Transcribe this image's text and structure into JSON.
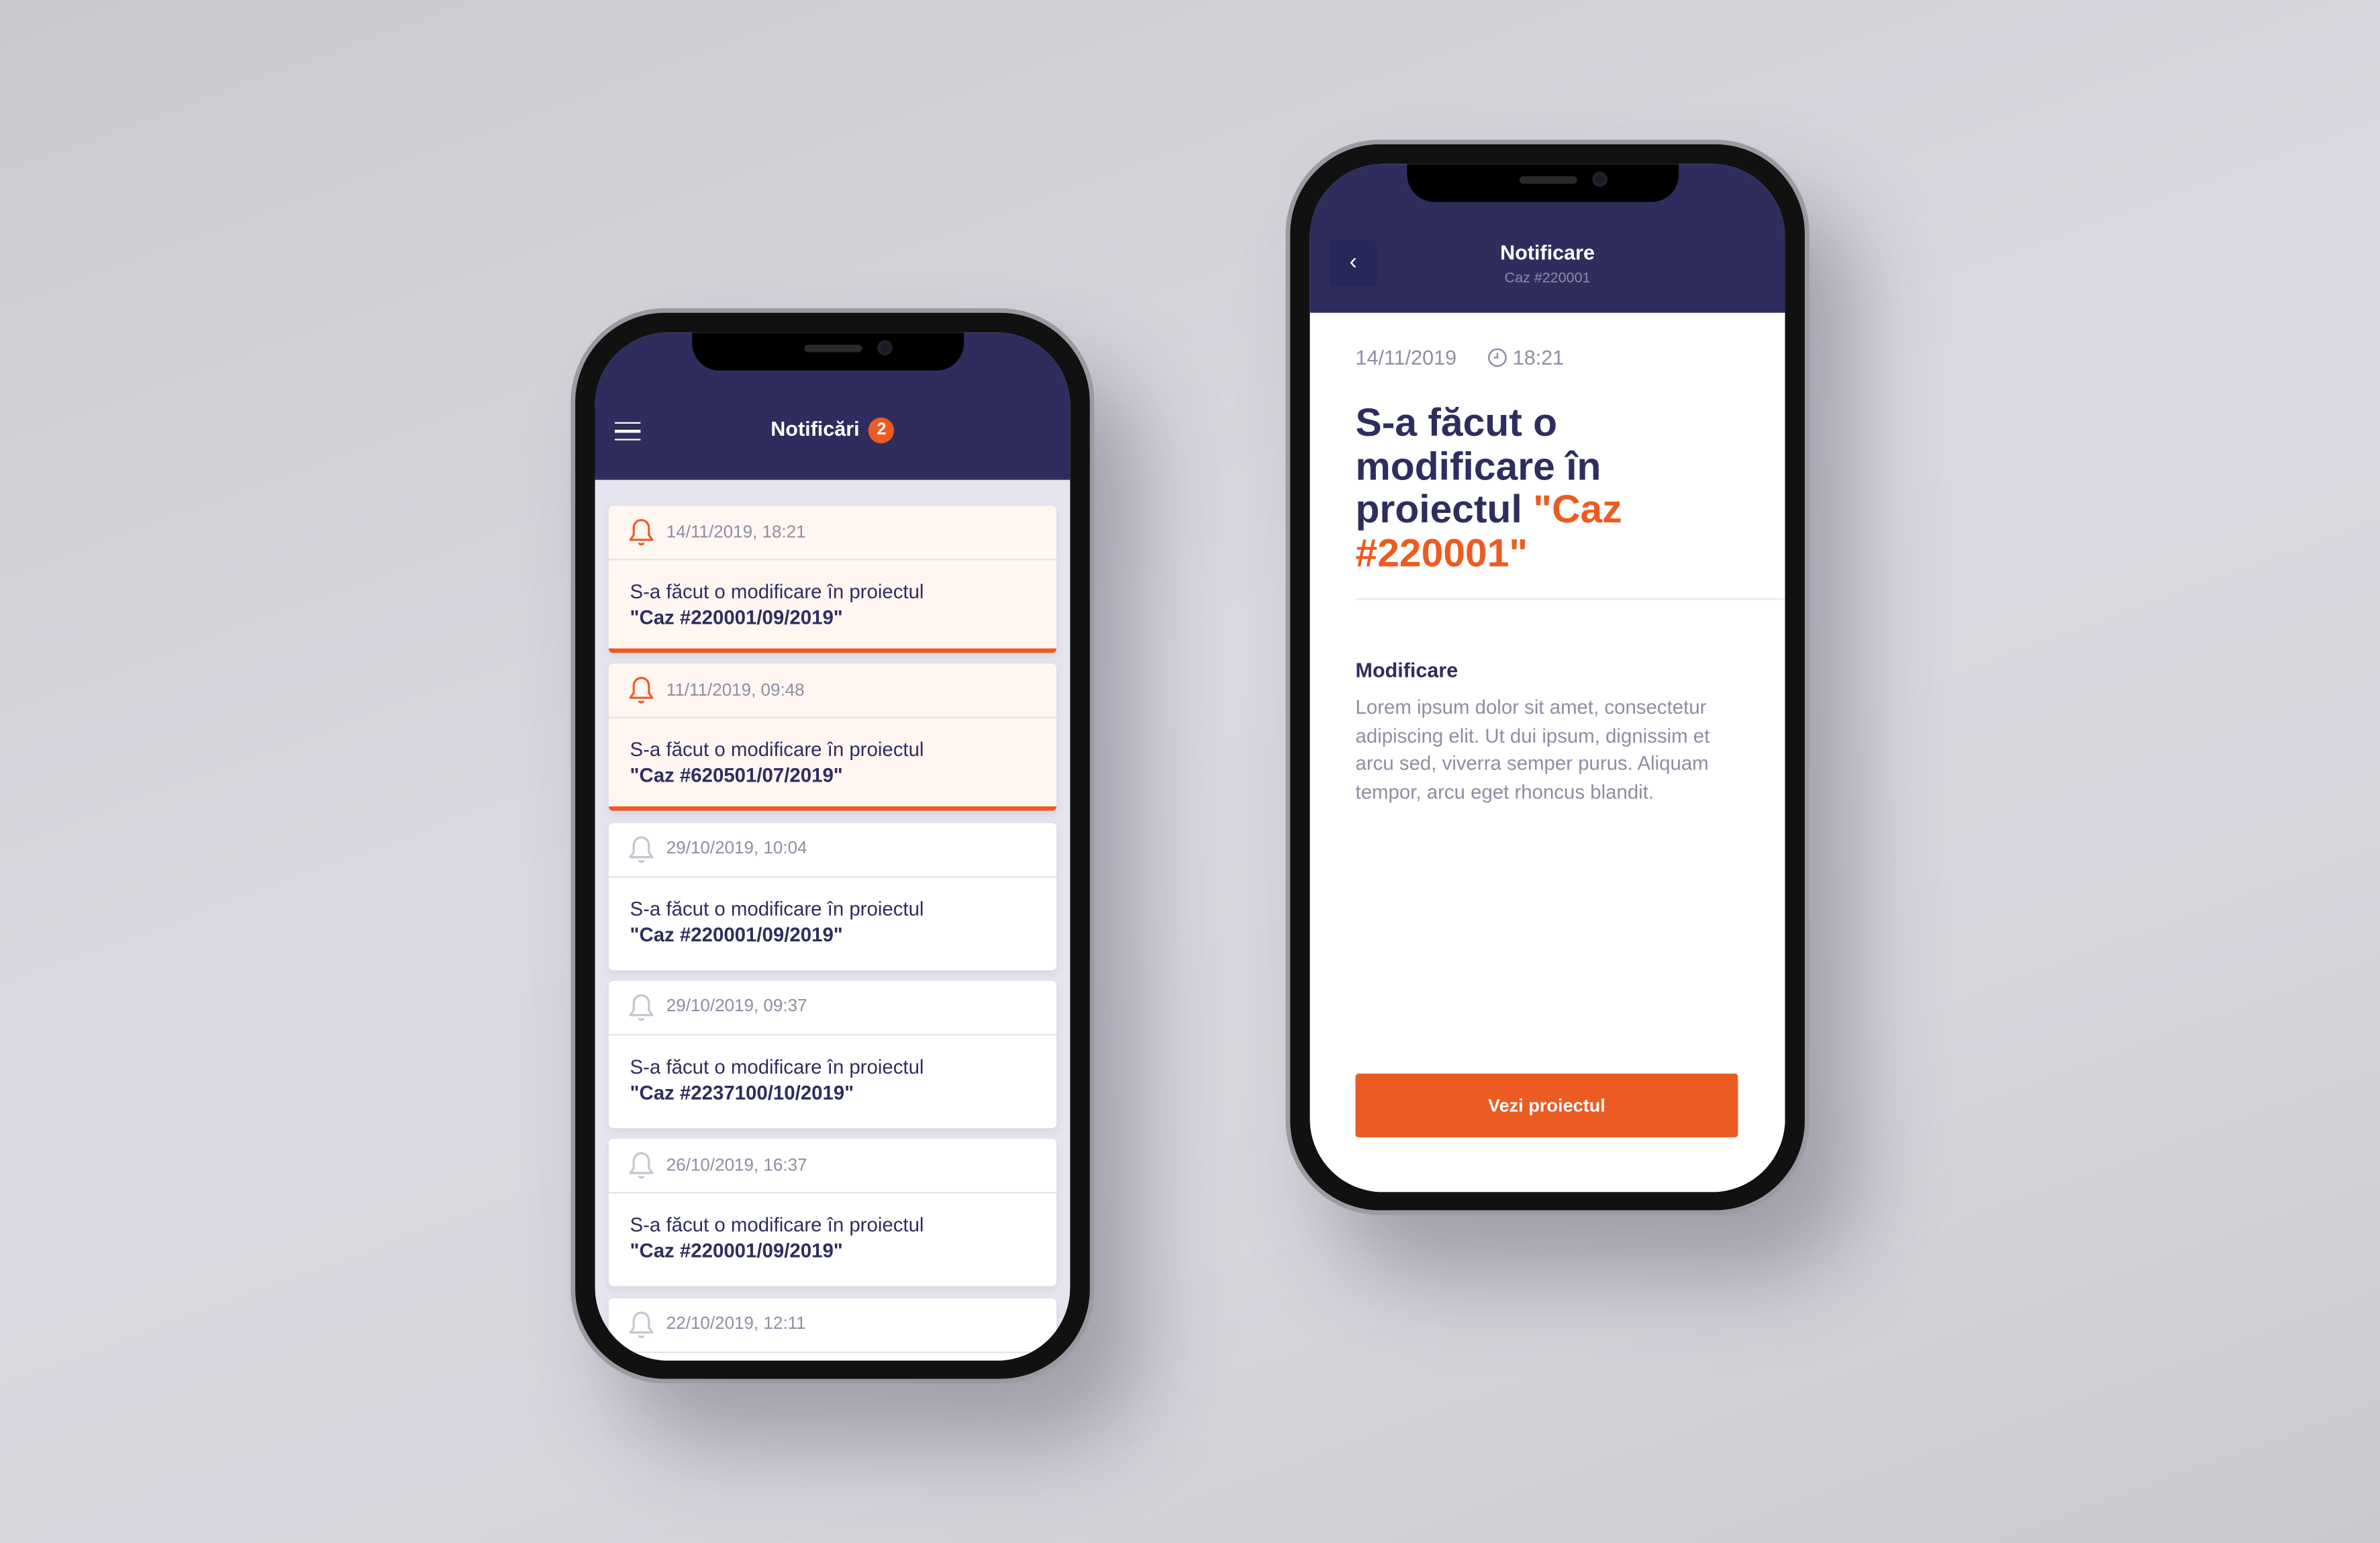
{
  "list_screen": {
    "title": "Notificări",
    "unread_count": "2",
    "notifications": [
      {
        "date": "14/11/2019, 18:21",
        "text": "S-a făcut o modificare în proiectul",
        "project": "\"Caz #220001/09/2019\"",
        "unread": true
      },
      {
        "date": "11/11/2019, 09:48",
        "text": "S-a făcut o modificare în proiectul",
        "project": "\"Caz #620501/07/2019\"",
        "unread": true
      },
      {
        "date": "29/10/2019, 10:04",
        "text": "S-a făcut o modificare în proiectul",
        "project": "\"Caz #220001/09/2019\"",
        "unread": false
      },
      {
        "date": "29/10/2019, 09:37",
        "text": "S-a făcut o modificare în proiectul",
        "project": "\"Caz #2237100/10/2019\"",
        "unread": false
      },
      {
        "date": "26/10/2019, 16:37",
        "text": "S-a făcut o modificare în proiectul",
        "project": "\"Caz #220001/09/2019\"",
        "unread": false
      },
      {
        "date": "22/10/2019, 12:11",
        "text": "",
        "project": "",
        "unread": false
      }
    ]
  },
  "detail_screen": {
    "title": "Notificare",
    "subtitle": "Caz #220001",
    "date": "14/11/2019",
    "time": "18:21",
    "heading": "S-a făcut o modificare în proiectul",
    "heading_highlight": "\"Caz #220001\"",
    "section_title": "Modificare",
    "section_body": "Lorem ipsum dolor sit amet, consectetur adipiscing elit. Ut dui ipsum, dignissim et arcu sed, viverra semper purus. Aliquam tempor, arcu eget rhoncus blandit.",
    "button_label": "Vezi proiectul"
  },
  "colors": {
    "primary": "#2e2d5e",
    "accent": "#ec5b22",
    "muted": "#8d8ea3"
  }
}
